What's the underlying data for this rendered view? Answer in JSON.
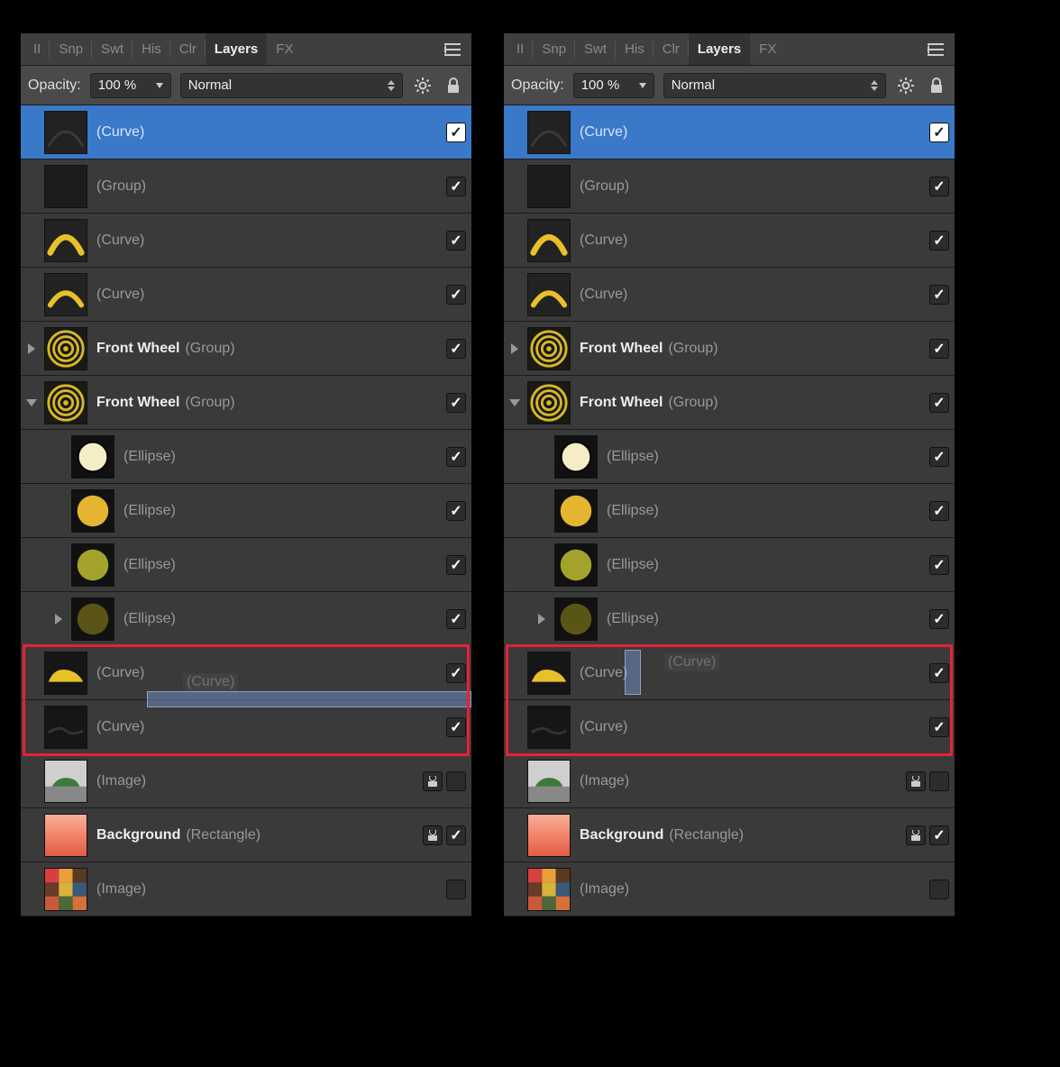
{
  "tabs": {
    "items": [
      "II",
      "Snp",
      "Swt",
      "His",
      "Clr",
      "Layers",
      "FX"
    ],
    "active": "Layers"
  },
  "toolbar": {
    "opacity_label": "Opacity:",
    "opacity_value": "100 %",
    "blend_mode": "Normal"
  },
  "layers": [
    {
      "name": "",
      "type": "(Curve)",
      "indent": 0,
      "expand": "none",
      "thumb": "curve-dark",
      "selected": true,
      "visible": true
    },
    {
      "name": "",
      "type": "(Group)",
      "indent": 0,
      "expand": "none",
      "thumb": "blank",
      "visible": true
    },
    {
      "name": "",
      "type": "(Curve)",
      "indent": 0,
      "expand": "none",
      "thumb": "arc-yellow",
      "visible": true
    },
    {
      "name": "",
      "type": "(Curve)",
      "indent": 0,
      "expand": "none",
      "thumb": "arc-yellow2",
      "visible": true
    },
    {
      "name": "Front Wheel",
      "type": "(Group)",
      "indent": 0,
      "expand": "closed",
      "thumb": "rings",
      "visible": true
    },
    {
      "name": "Front Wheel",
      "type": "(Group)",
      "indent": 0,
      "expand": "open",
      "thumb": "rings",
      "visible": true
    },
    {
      "name": "",
      "type": "(Ellipse)",
      "indent": 1,
      "expand": "none",
      "thumb": "circle-cream",
      "visible": true
    },
    {
      "name": "",
      "type": "(Ellipse)",
      "indent": 1,
      "expand": "none",
      "thumb": "circle-gold",
      "visible": true
    },
    {
      "name": "",
      "type": "(Ellipse)",
      "indent": 1,
      "expand": "none",
      "thumb": "circle-olive",
      "visible": true
    },
    {
      "name": "",
      "type": "(Ellipse)",
      "indent": 1,
      "expand": "closed",
      "thumb": "circle-dark",
      "visible": true
    },
    {
      "name": "",
      "type": "(Curve)",
      "indent": 0,
      "expand": "none",
      "thumb": "car-yellow",
      "visible": true
    },
    {
      "name": "",
      "type": "(Curve)",
      "indent": 0,
      "expand": "none",
      "thumb": "line-dark",
      "visible": true
    },
    {
      "name": "",
      "type": "(Image)",
      "indent": 0,
      "expand": "none",
      "thumb": "car-photo",
      "visible": false,
      "locked": true
    },
    {
      "name": "Background",
      "type": "(Rectangle)",
      "indent": 0,
      "expand": "none",
      "thumb": "gradient",
      "visible": true,
      "locked": true
    },
    {
      "name": "",
      "type": "(Image)",
      "indent": 0,
      "expand": "none",
      "thumb": "mosaic",
      "visible": false
    }
  ],
  "drag_ghost": "(Curve)",
  "panels": [
    {
      "highlight_rows": [
        10,
        11
      ],
      "drag_mode": "between"
    },
    {
      "highlight_rows": [
        10,
        11
      ],
      "drag_mode": "into"
    }
  ]
}
